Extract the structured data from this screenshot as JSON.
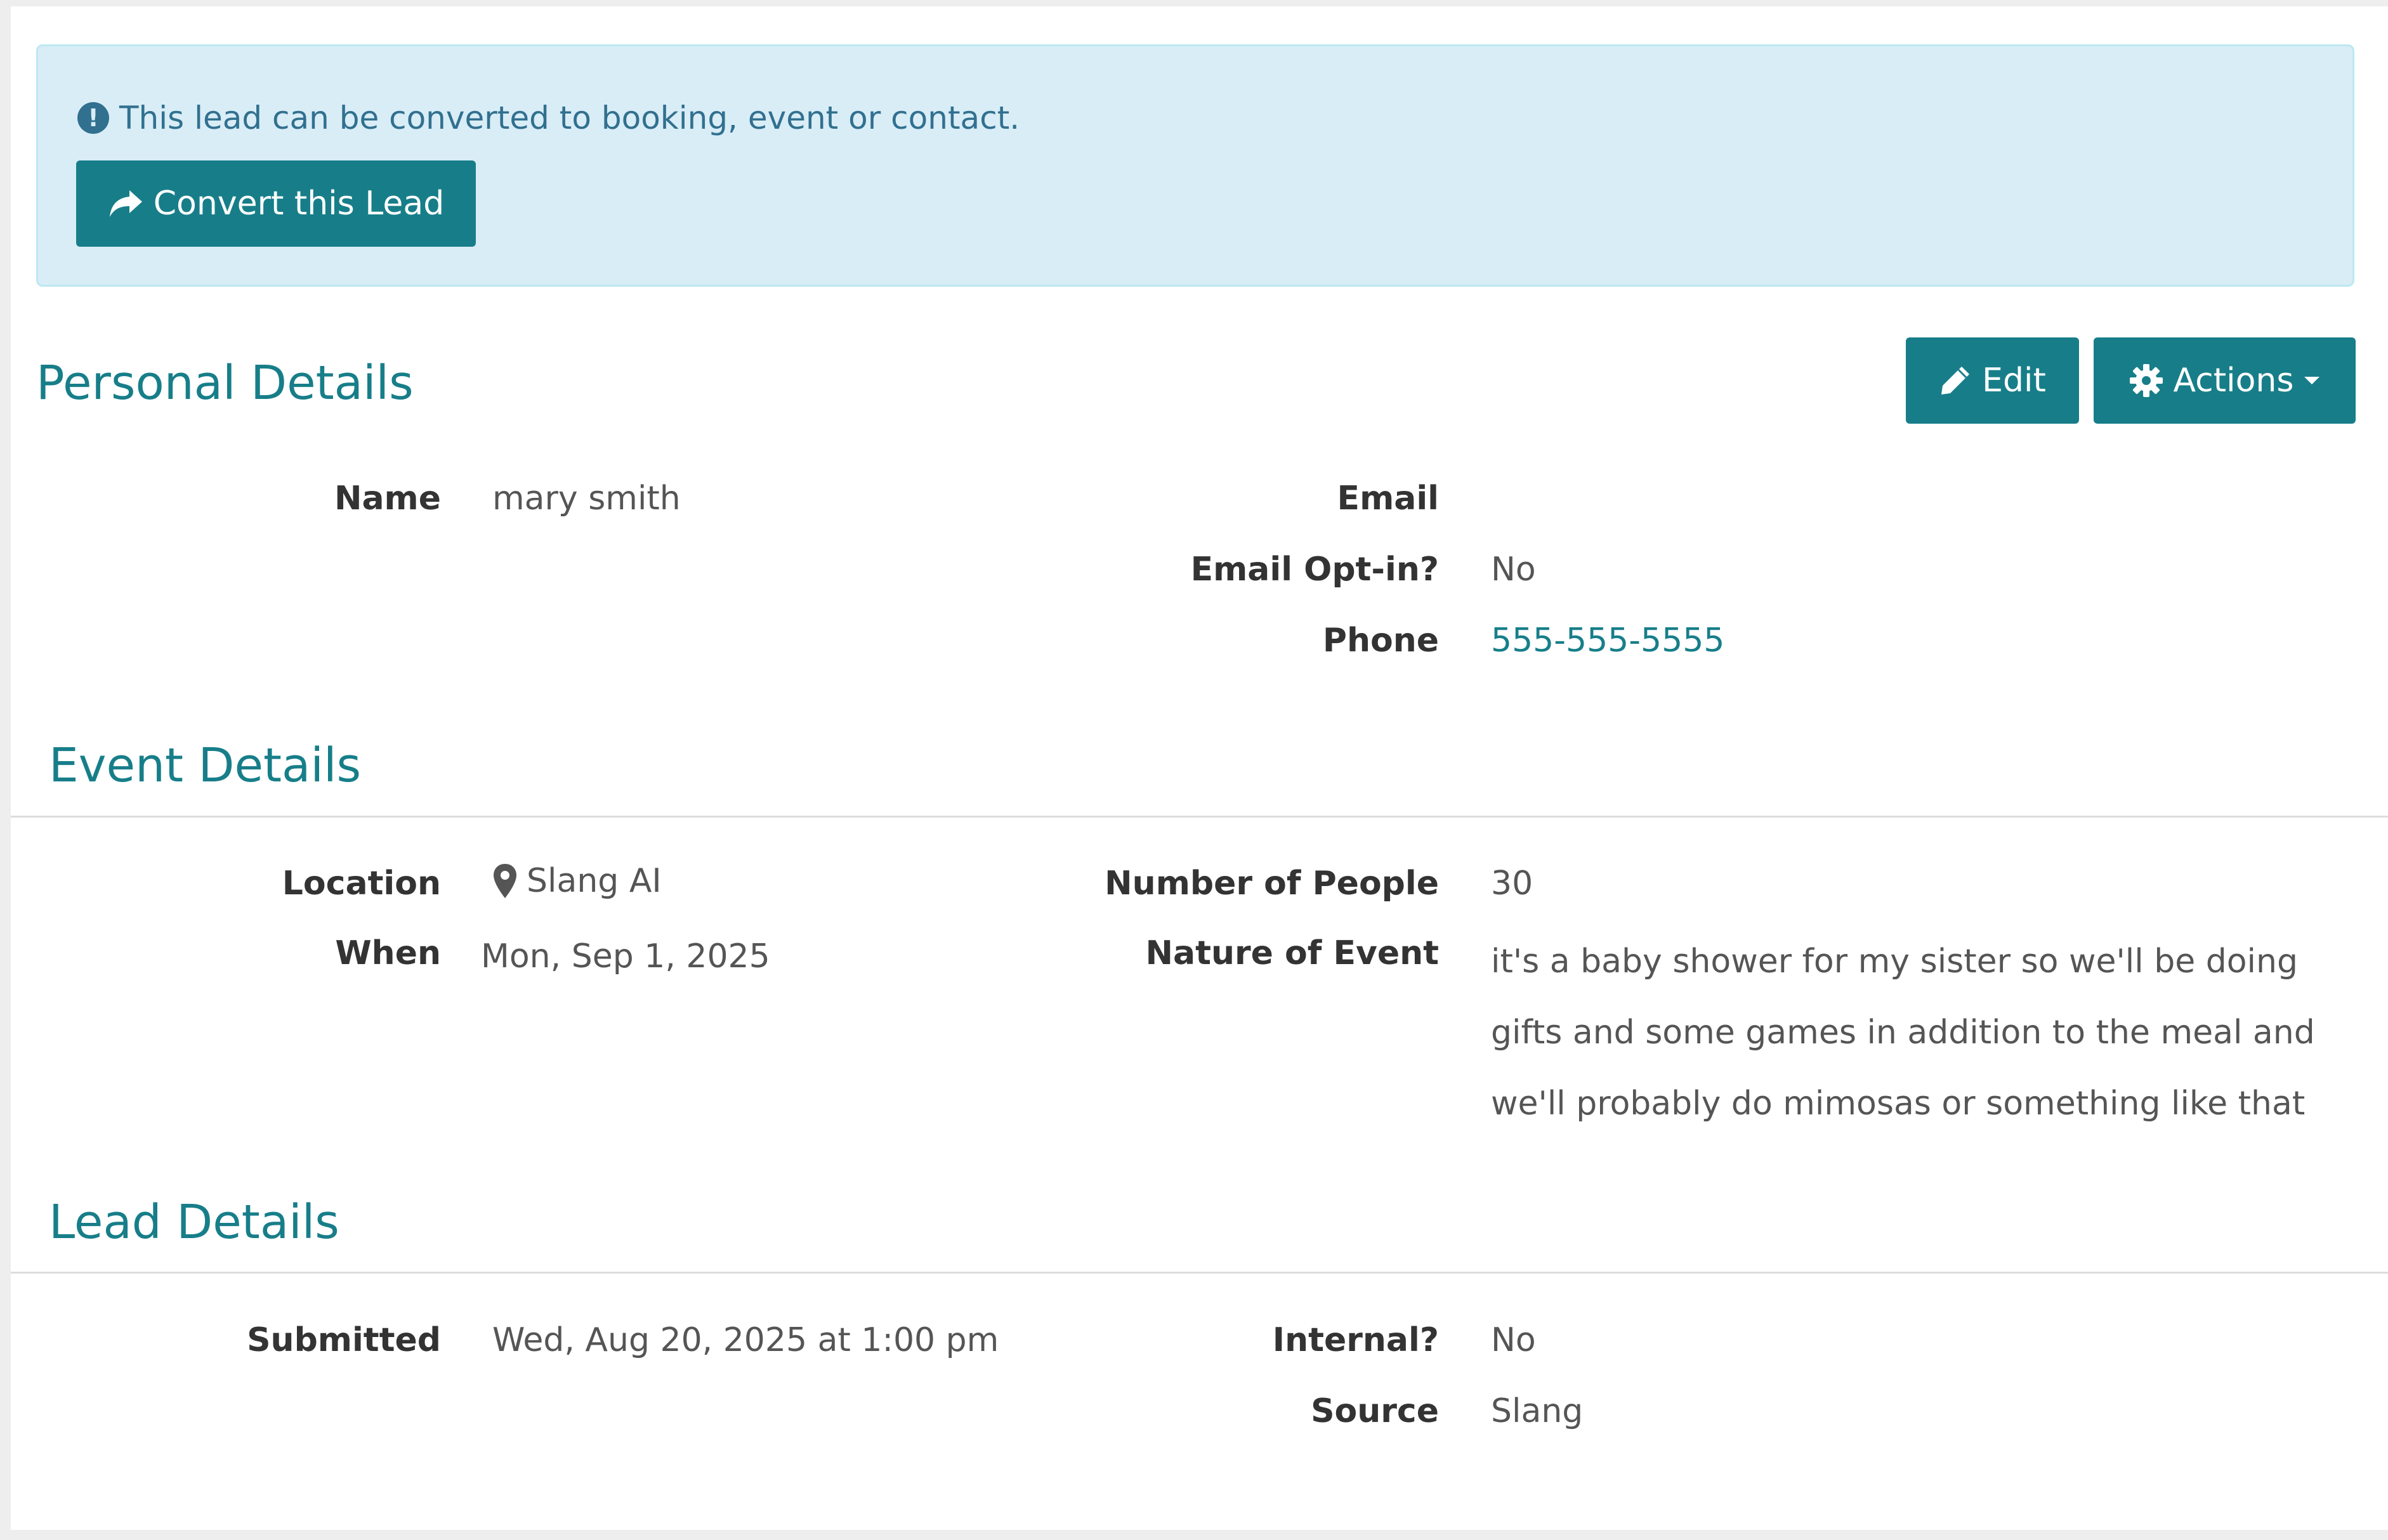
{
  "alert": {
    "message": "This lead can be converted to booking, event or contact.",
    "icon": "exclamation-circle-icon",
    "convert_label": "Convert this Lead"
  },
  "personal": {
    "title": "Personal Details",
    "edit_label": "Edit",
    "actions_label": "Actions",
    "name_label": "Name",
    "name_value": "mary smith",
    "email_label": "Email",
    "email_value": "",
    "optin_label": "Email Opt-in?",
    "optin_value": "No",
    "phone_label": "Phone",
    "phone_value": "555-555-5555"
  },
  "event": {
    "title": "Event Details",
    "location_label": "Location",
    "location_value": "Slang AI",
    "when_label": "When",
    "when_value": "Mon, Sep 1, 2025",
    "people_label": "Number of People",
    "people_value": "30",
    "nature_label": "Nature of Event",
    "nature_value": "it's a baby shower for my sister so we'll be doing gifts and some games in addition to the meal and we'll probably do mimosas or something like that"
  },
  "lead": {
    "title": "Lead Details",
    "submitted_label": "Submitted",
    "submitted_value": "Wed, Aug 20, 2025 at 1:00 pm",
    "internal_label": "Internal?",
    "internal_value": "No",
    "source_label": "Source",
    "source_value": "Slang"
  },
  "colors": {
    "accent": "#177e89",
    "alert_bg": "#d9edf7",
    "alert_text": "#31708f"
  }
}
